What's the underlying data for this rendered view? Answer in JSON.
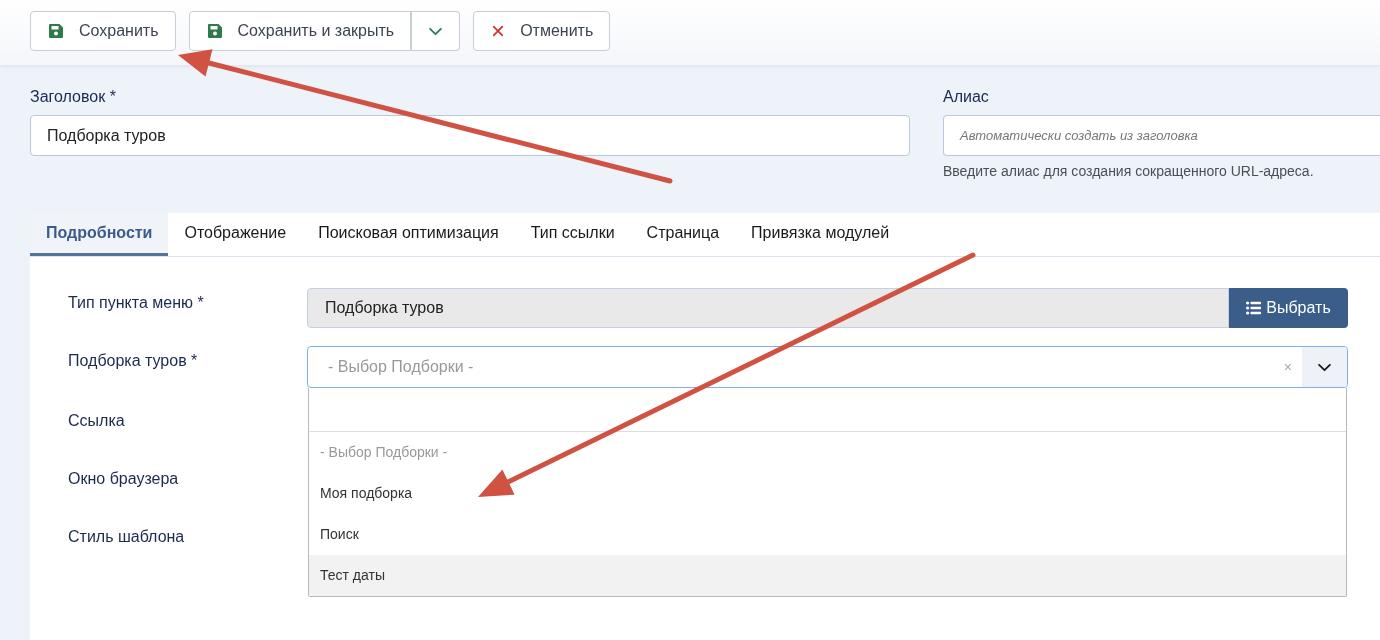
{
  "toolbar": {
    "buttons": [
      {
        "kind": "save",
        "label": "Сохранить"
      },
      {
        "kind": "split",
        "label": "Сохранить и закрыть"
      },
      {
        "kind": "cancel",
        "label": "Отменить"
      }
    ]
  },
  "title_field": {
    "label": "Заголовок *",
    "value": "Подборка туров"
  },
  "alias_field": {
    "label": "Алиас",
    "placeholder": "Автоматически создать из заголовка",
    "help": "Введите алиас для создания сокращенного URL-адреса."
  },
  "tabs": [
    {
      "label": "Подробности",
      "selected": true
    },
    {
      "label": "Отображение",
      "selected": false
    },
    {
      "label": "Поисковая оптимизация",
      "selected": false
    },
    {
      "label": "Тип ссылки",
      "selected": false
    },
    {
      "label": "Страница",
      "selected": false
    },
    {
      "label": "Привязка модулей",
      "selected": false
    }
  ],
  "form": {
    "rows": [
      {
        "kind": "readonly_picker",
        "label": "Тип пункта меню *",
        "value": "Подборка туров",
        "button": "Выбрать"
      },
      {
        "kind": "select",
        "label": "Подборка туров *",
        "placeholder": "- Выбор Подборки -",
        "clear": "×",
        "expanded": true,
        "options": [
          {
            "kind": "placeholder",
            "label": "- Выбор Подборки -",
            "highlighted": false
          },
          {
            "kind": "option",
            "label": "Моя подборка",
            "highlighted": false
          },
          {
            "kind": "option",
            "label": "Поиск",
            "highlighted": false
          },
          {
            "kind": "option",
            "label": "Тест даты",
            "highlighted": true
          }
        ]
      },
      {
        "kind": "covered",
        "label": "Ссылка"
      },
      {
        "kind": "covered",
        "label": "Окно браузера"
      },
      {
        "kind": "covered",
        "label": "Стиль шаблона"
      }
    ]
  }
}
